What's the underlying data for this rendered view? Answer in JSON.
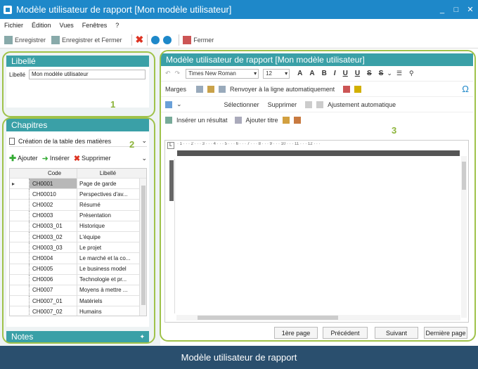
{
  "window": {
    "title": "Modèle utilisateur de rapport [Mon modèle utilisateur]",
    "minimize": "_",
    "maximize": "□",
    "close": "✕"
  },
  "menu": [
    "Fichier",
    "Édition",
    "Vues",
    "Fenêtres",
    "?"
  ],
  "toolbar": {
    "save": "Enregistrer",
    "save_close": "Enregistrer et Fermer",
    "close": "Fermer"
  },
  "libelle": {
    "header": "Libellé",
    "label": "Libellé",
    "value": "Mon modèle utilisateur"
  },
  "chapitres": {
    "header": "Chapitres",
    "selected": "Création de la table des matières",
    "add": "Ajouter",
    "insert": "Insérer",
    "delete": "Supprimer",
    "columns": [
      "Code",
      "Libellé"
    ],
    "rows": [
      {
        "code": "CH0001",
        "label": "Page de garde"
      },
      {
        "code": "CH00010",
        "label": "Perspectives d'av..."
      },
      {
        "code": "CH0002",
        "label": "Résumé"
      },
      {
        "code": "CH0003",
        "label": "Présentation"
      },
      {
        "code": "CH0003_01",
        "label": "Historique"
      },
      {
        "code": "CH0003_02",
        "label": "L'équipe"
      },
      {
        "code": "CH0003_03",
        "label": "Le projet"
      },
      {
        "code": "CH0004",
        "label": "Le marché et la co..."
      },
      {
        "code": "CH0005",
        "label": "Le business model"
      },
      {
        "code": "CH0006",
        "label": "Technologie et pr..."
      },
      {
        "code": "CH0007",
        "label": "Moyens à mettre ..."
      },
      {
        "code": "CH0007_01",
        "label": "Matériels"
      },
      {
        "code": "CH0007_02",
        "label": "Humains"
      }
    ]
  },
  "notes": {
    "header": "Notes"
  },
  "editor": {
    "header": "Modèle utilisateur de rapport [Mon modèle utilisateur]",
    "font": "Times New Roman",
    "size": "12",
    "margins": "Marges",
    "wrap": "Renvoyer à la ligne automatiquement",
    "select": "Sélectionner",
    "delete": "Supprimer",
    "autofit": "Ajustement automatique",
    "insert_result": "Insérer un résultat",
    "add_title": "Ajouter titre",
    "ruler": "· 1 · · · 2 · · · 3 · · · 4 · · · 5 · · · 6 · · · 7 · · · 8 · · · 9 · · · 10 · · · 11 · · · 12 · · ·"
  },
  "pager": {
    "first": "1ère page",
    "prev": "Précédent",
    "next": "Suivant",
    "last": "Dernière page"
  },
  "footer": "Modèle utilisateur de rapport",
  "callouts": [
    "1",
    "2",
    "3"
  ],
  "colors": {
    "titlebar": "#1e88c9",
    "panel_header": "#3aa0a7",
    "footer": "#2a4f6e",
    "highlight": "#9fc24a"
  }
}
